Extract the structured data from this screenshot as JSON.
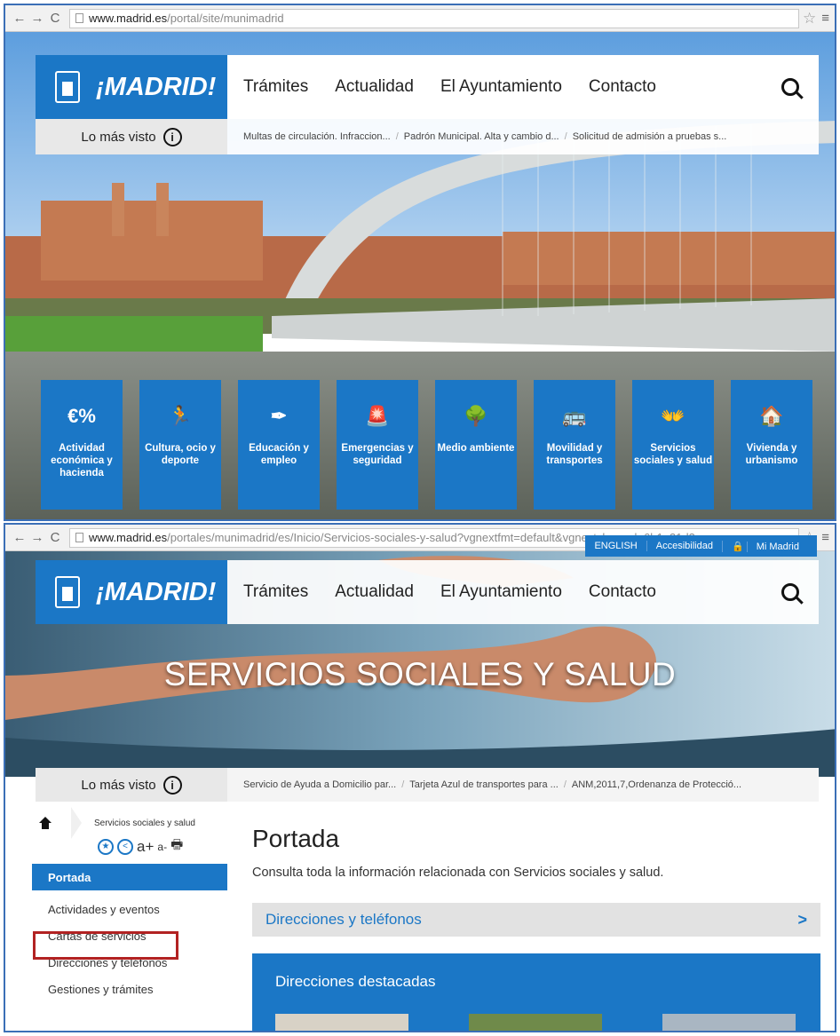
{
  "colors": {
    "brand_blue": "#1b77c6",
    "highlight_red": "#b22222"
  },
  "screen1": {
    "url_host": "www.madrid.es",
    "url_path": "/portal/site/munimadrid",
    "logo_text": "¡MADRID!",
    "nav": [
      "Trámites",
      "Actualidad",
      "El Ayuntamiento",
      "Contacto"
    ],
    "most_viewed_label": "Lo más visto",
    "trending": [
      "Multas de circulación. Infraccion...",
      "Padrón Municipal. Alta y cambio d...",
      "Solicitud de admisión a pruebas s..."
    ],
    "tiles": [
      {
        "icon": "€%",
        "label": "Actividad económica y hacienda",
        "icon_name": "euro-percent-icon"
      },
      {
        "icon": "🏃",
        "label": "Cultura, ocio y deporte",
        "icon_name": "runner-icon"
      },
      {
        "icon": "✒",
        "label": "Educación y empleo",
        "icon_name": "pen-icon"
      },
      {
        "icon": "🚨",
        "label": "Emergencias y seguridad",
        "icon_name": "siren-icon"
      },
      {
        "icon": "🌳",
        "label": "Medio ambiente",
        "icon_name": "tree-icon"
      },
      {
        "icon": "🚌",
        "label": "Movilidad y transportes",
        "icon_name": "bus-icon"
      },
      {
        "icon": "👐",
        "label": "Servicios sociales y salud",
        "icon_name": "hands-icon"
      },
      {
        "icon": "🏠",
        "label": "Vivienda y urbanismo",
        "icon_name": "house-icon"
      }
    ]
  },
  "screen2": {
    "url_host": "www.madrid.es",
    "url_path": "/portales/munimadrid/es/Inicio/Servicios-sociales-y-salud?vgnextfmt=default&vgnextchannel=6b1e31d3",
    "top_links": [
      "ENGLISH",
      "Accesibilidad",
      "Mi Madrid"
    ],
    "logo_text": "¡MADRID!",
    "nav": [
      "Trámites",
      "Actualidad",
      "El Ayuntamiento",
      "Contacto"
    ],
    "banner_title": "SERVICIOS SOCIALES Y SALUD",
    "most_viewed_label": "Lo más visto",
    "trending": [
      "Servicio de Ayuda a Domicilio par...",
      "Tarjeta Azul de transportes para ...",
      "ANM,2011,7,Ordenanza de Protecció..."
    ],
    "breadcrumb": "Servicios sociales y salud",
    "tools": {
      "font_up": "a+",
      "font_down": "a-"
    },
    "sidebar": [
      "Portada",
      "Actividades y eventos",
      "Cartas de servicios",
      "Direcciones y teléfonos",
      "Gestiones y trámites"
    ],
    "page_title": "Portada",
    "intro": "Consulta toda la información relacionada con Servicios sociales y salud.",
    "directions_bar": "Direcciones y teléfonos",
    "featured_title": "Direcciones destacadas"
  }
}
